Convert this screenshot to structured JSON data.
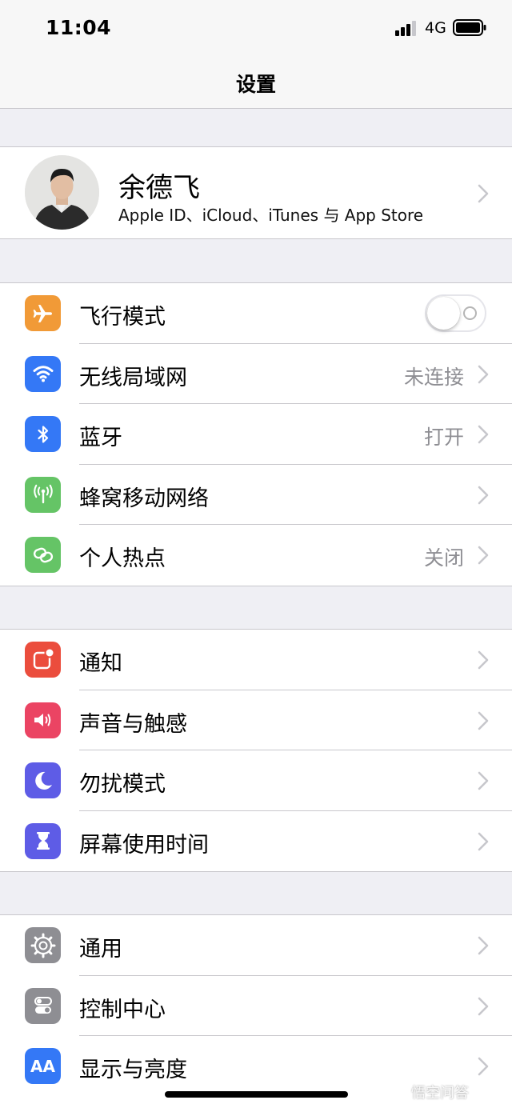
{
  "status_bar": {
    "time": "11:04",
    "network": "4G"
  },
  "nav": {
    "title": "设置"
  },
  "profile": {
    "name": "余德飞",
    "subtitle": "Apple ID、iCloud、iTunes 与 App Store"
  },
  "groups": [
    {
      "rows": [
        {
          "label": "飞行模式",
          "icon": "airplane-icon",
          "color": "#f19a37",
          "toggle": false
        },
        {
          "label": "无线局域网",
          "icon": "wifi-icon",
          "color": "#3478f6",
          "value": "未连接"
        },
        {
          "label": "蓝牙",
          "icon": "bluetooth-icon",
          "color": "#3478f6",
          "value": "打开"
        },
        {
          "label": "蜂窝移动网络",
          "icon": "cellular-icon",
          "color": "#65c466"
        },
        {
          "label": "个人热点",
          "icon": "hotspot-icon",
          "color": "#65c466",
          "value": "关闭"
        }
      ]
    },
    {
      "rows": [
        {
          "label": "通知",
          "icon": "notifications-icon",
          "color": "#eb4d3d"
        },
        {
          "label": "声音与触感",
          "icon": "sound-icon",
          "color": "#eb4463"
        },
        {
          "label": "勿扰模式",
          "icon": "moon-icon",
          "color": "#5e5ce6"
        },
        {
          "label": "屏幕使用时间",
          "icon": "hourglass-icon",
          "color": "#5e5ce6"
        }
      ]
    },
    {
      "rows": [
        {
          "label": "通用",
          "icon": "gear-icon",
          "color": "#8e8e93"
        },
        {
          "label": "控制中心",
          "icon": "control-center-icon",
          "color": "#8e8e93"
        },
        {
          "label": "显示与亮度",
          "icon": "display-icon",
          "color": "#3478f6",
          "icon_text": "AA"
        }
      ]
    }
  ],
  "watermark": "悟空问答"
}
